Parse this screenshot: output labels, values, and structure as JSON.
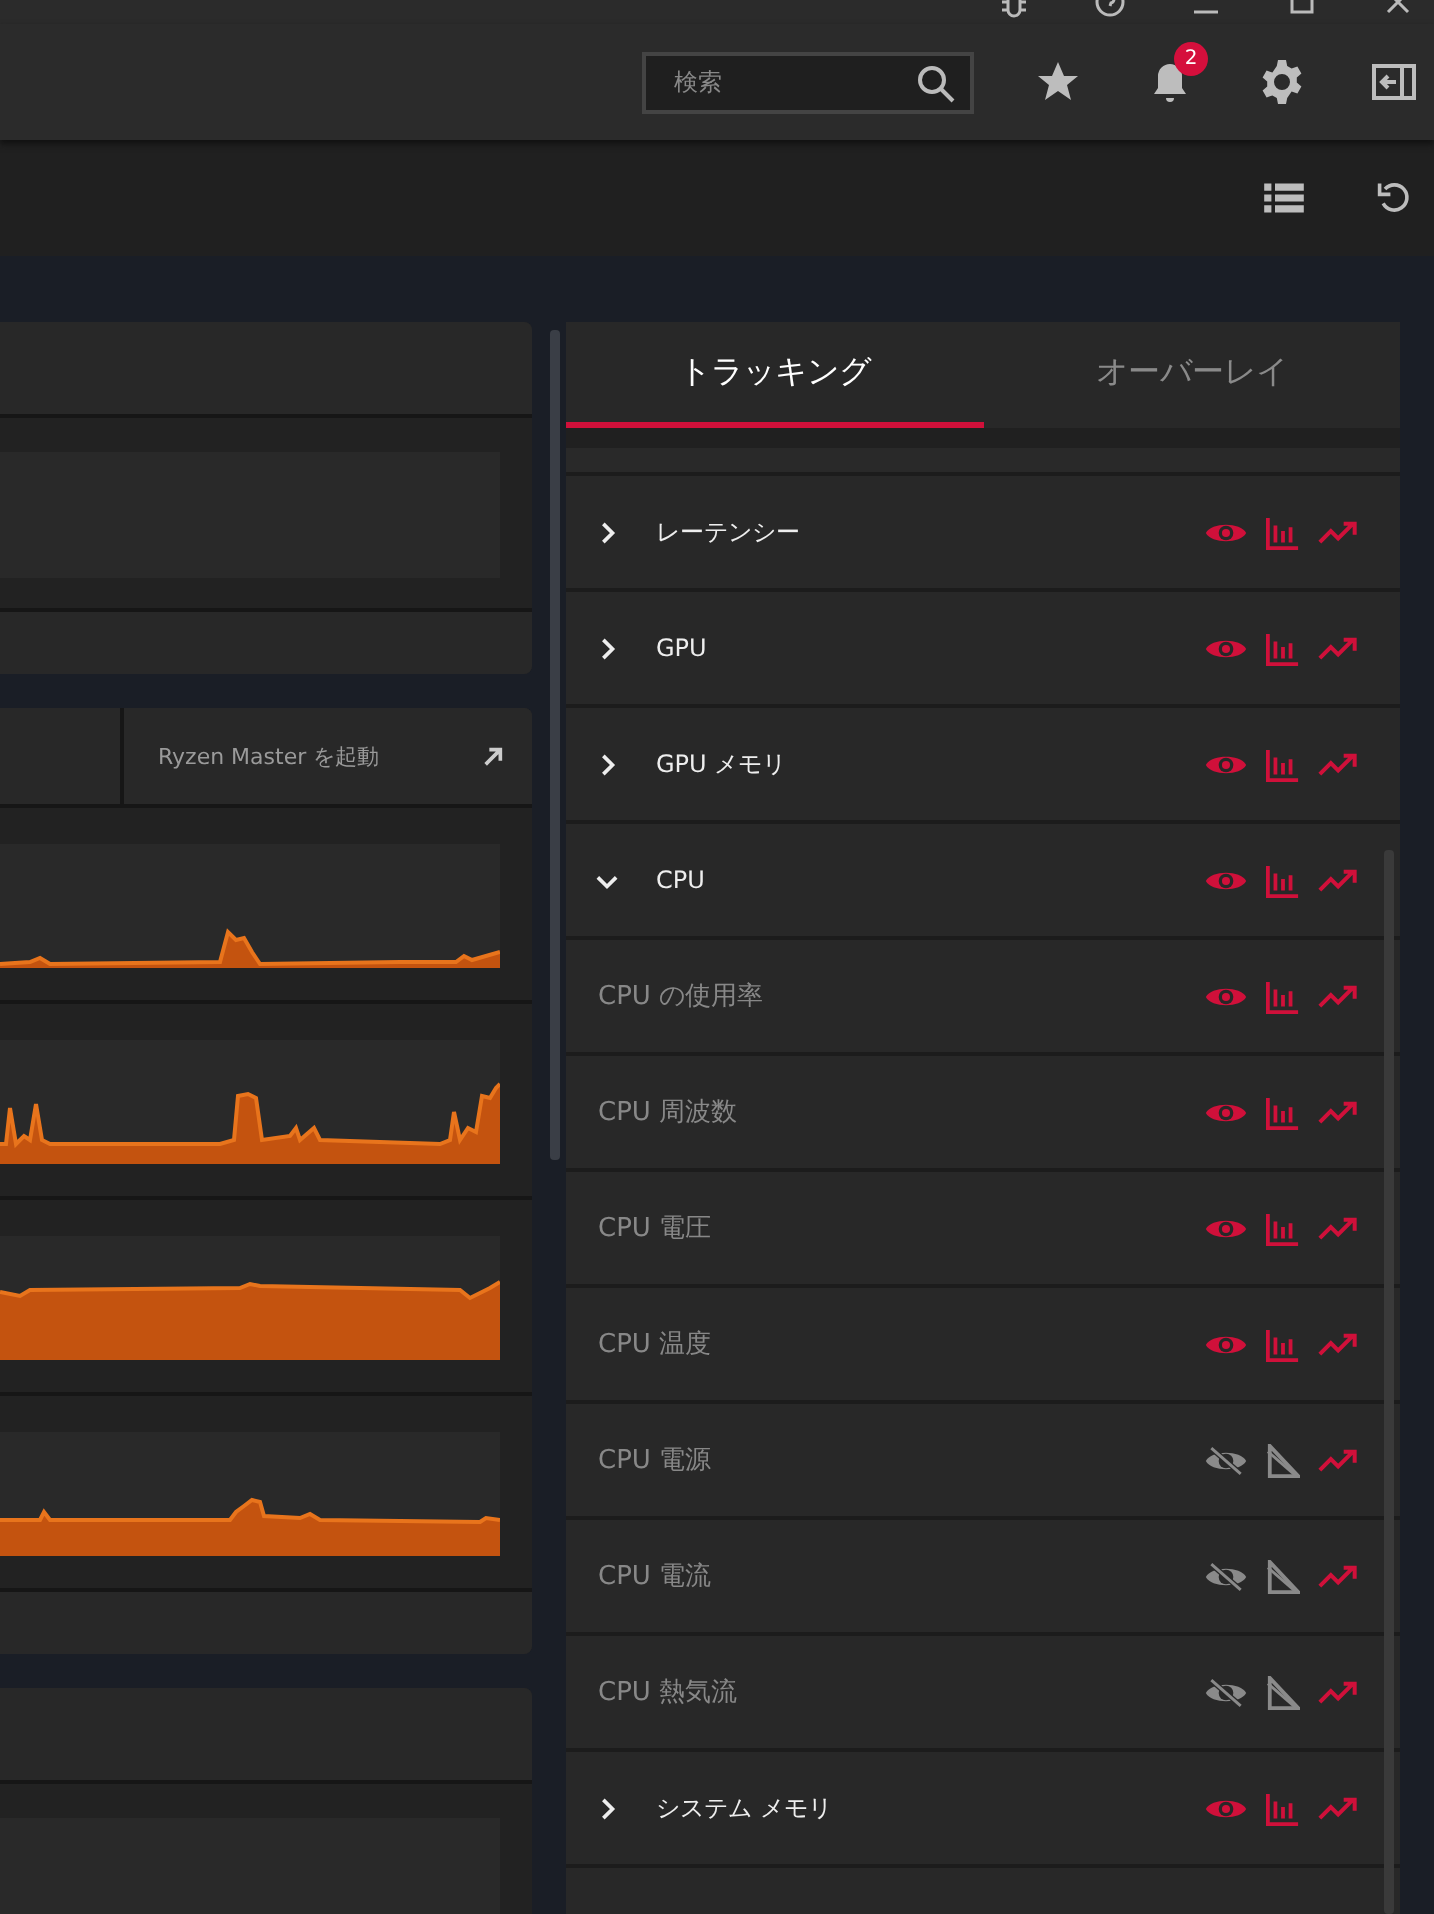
{
  "search": {
    "placeholder": "検索"
  },
  "notifications": {
    "badge": "2"
  },
  "launch_button": {
    "label": "Ryzen Master を起動"
  },
  "tabs": [
    {
      "label": "トラッキング",
      "selected": true
    },
    {
      "label": "オーバーレイ",
      "selected": false
    }
  ],
  "metrics": [
    {
      "kind": "group",
      "label": "レーテンシー",
      "expanded": false,
      "overlay": true,
      "graph": true,
      "trend": true
    },
    {
      "kind": "group",
      "label": "GPU",
      "expanded": false,
      "overlay": true,
      "graph": true,
      "trend": true
    },
    {
      "kind": "group",
      "label": "GPU メモリ",
      "expanded": false,
      "overlay": true,
      "graph": true,
      "trend": true
    },
    {
      "kind": "group",
      "label": "CPU",
      "expanded": true,
      "overlay": true,
      "graph": true,
      "trend": true,
      "children": [
        {
          "kind": "metric",
          "label": "CPU の使用率",
          "overlay": true,
          "graph": true,
          "trend": true
        },
        {
          "kind": "metric",
          "label": "CPU 周波数",
          "overlay": true,
          "graph": true,
          "trend": true
        },
        {
          "kind": "metric",
          "label": "CPU 電圧",
          "overlay": true,
          "graph": true,
          "trend": true
        },
        {
          "kind": "metric",
          "label": "CPU 温度",
          "overlay": true,
          "graph": true,
          "trend": true
        },
        {
          "kind": "metric",
          "label": "CPU 電源",
          "overlay": false,
          "graph": false,
          "trend": true
        },
        {
          "kind": "metric",
          "label": "CPU 電流",
          "overlay": false,
          "graph": false,
          "trend": true
        },
        {
          "kind": "metric",
          "label": "CPU 熱気流",
          "overlay": false,
          "graph": false,
          "trend": true
        }
      ]
    },
    {
      "kind": "group",
      "label": "システム メモリ",
      "expanded": false,
      "overlay": true,
      "graph": true,
      "trend": true
    }
  ]
}
